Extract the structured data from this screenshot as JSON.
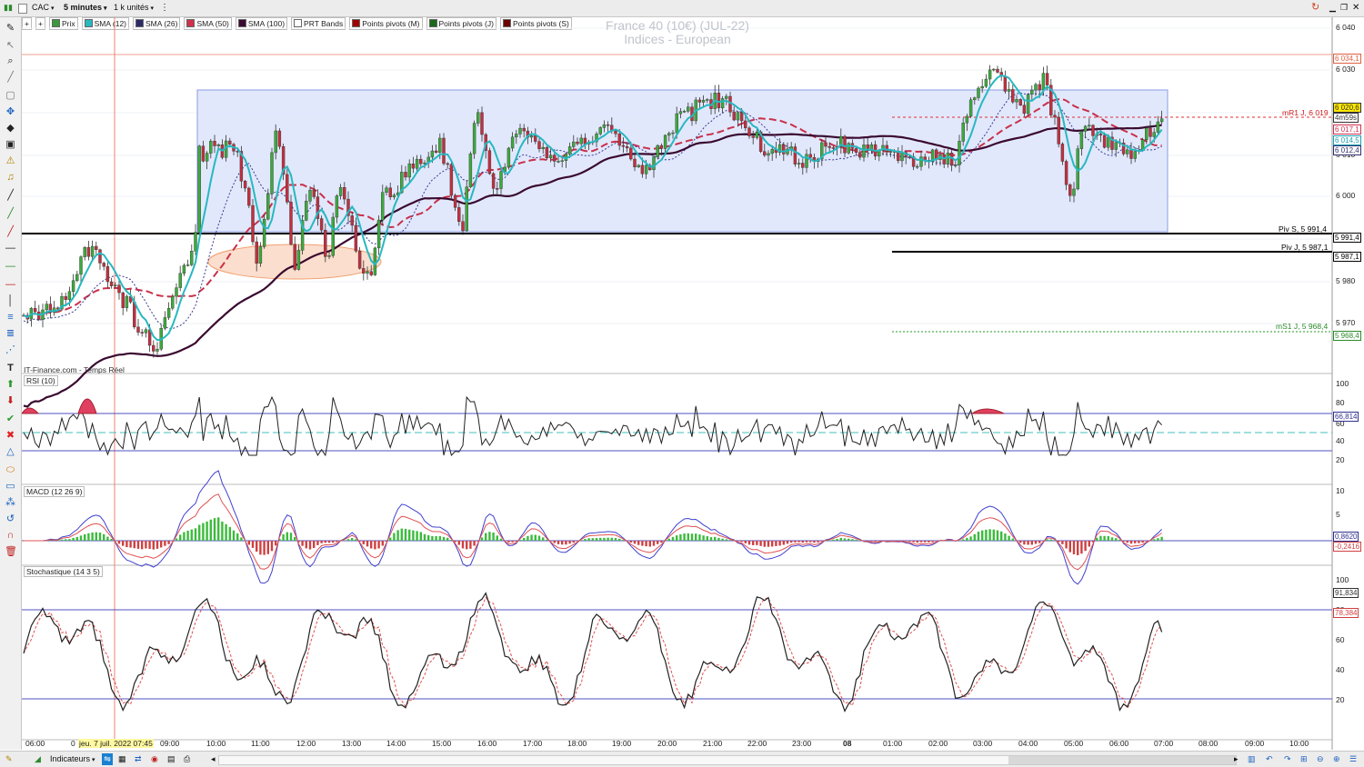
{
  "topbar": {
    "symbol": "CAC",
    "interval": "5 minutes",
    "units": "1 k unités"
  },
  "legend": [
    {
      "label": "Prix",
      "color": "#3a9a3a"
    },
    {
      "label": "SMA (12)",
      "color": "#27b8c0"
    },
    {
      "label": "SMA (26)",
      "color": "#2b2b6b"
    },
    {
      "label": "SMA (50)",
      "color": "#d0304a"
    },
    {
      "label": "SMA (100)",
      "color": "#3a0a30"
    },
    {
      "label": "PRT Bands",
      "color": "#ffffff"
    },
    {
      "label": "Points pivots (M)",
      "color": "#a00000"
    },
    {
      "label": "Points pivots (J)",
      "color": "#1a6a1a"
    },
    {
      "label": "Points pivots (S)",
      "color": "#6a0000"
    }
  ],
  "chart": {
    "title_line1": "France 40 (10€) (JUL-22)",
    "title_line2": "Indices - European",
    "source": "IT-Finance.com - Temps Réel",
    "price_ticks": [
      "6 040",
      "6 030",
      "6 020",
      "6 010",
      "6 000",
      "5 990",
      "5 980",
      "5 970"
    ],
    "tags": [
      {
        "text": "6 034,1",
        "color": "#e06040",
        "bg": "#ffffff"
      },
      {
        "text": "6 020,6",
        "color": "#333333",
        "bg": "#ffe800"
      },
      {
        "text": "4m59s",
        "color": "#333333",
        "bg": "#ffffff"
      },
      {
        "text": "6 017,1",
        "color": "#d03050",
        "bg": "#ffffff"
      },
      {
        "text": "6 014,5",
        "color": "#1aa0b0",
        "bg": "#ffffff"
      },
      {
        "text": "6 012,4",
        "color": "#303070",
        "bg": "#ffffff"
      },
      {
        "text": "5 991,4",
        "color": "#000000",
        "bg": "#ffffff"
      },
      {
        "text": "5 987,1",
        "color": "#000000",
        "bg": "#ffffff"
      },
      {
        "text": "5 968,4",
        "color": "#2a8a2a",
        "bg": "#ffffff"
      }
    ],
    "pivot_labels": {
      "mr1": "mR1 J, 6 019",
      "pivs": "Piv S, 5 991,4",
      "pivj": "Piv J, 5 987,1",
      "ms1": "mS1 J, 5 968,4"
    },
    "colors": {
      "up": "#3caa3c",
      "down": "#c03040",
      "sma12": "#27b8c0",
      "sma26": "#3a3a90",
      "sma50": "#c8304a",
      "sma100": "#3a0a30",
      "box": "#dde4fb"
    }
  },
  "rsi": {
    "title": "RSI (10)",
    "ticks": [
      "100",
      "80",
      "60",
      "40",
      "20"
    ],
    "value": "66,814"
  },
  "macd": {
    "title": "MACD (12 26 9)",
    "ticks": [
      "10",
      "5"
    ],
    "value1": "0,8620",
    "value2": "-0,2416"
  },
  "stoch": {
    "title": "Stochastique (14 3 5)",
    "ticks": [
      "100",
      "80",
      "60",
      "40",
      "20"
    ],
    "value1": "91,834",
    "value2": "78,384"
  },
  "time_axis": [
    "06:00",
    "0",
    "jeu. 7 juil. 2022 07:45",
    "09:00",
    "10:00",
    "11:00",
    "12:00",
    "13:00",
    "14:00",
    "15:00",
    "16:00",
    "17:00",
    "18:00",
    "19:00",
    "20:00",
    "21:00",
    "22:00",
    "23:00",
    "08",
    "01:00",
    "02:00",
    "03:00",
    "04:00",
    "05:00",
    "06:00",
    "07:00",
    "08:00",
    "09:00",
    "10:00"
  ],
  "bottombar": {
    "indicators_label": "Indicateurs"
  }
}
